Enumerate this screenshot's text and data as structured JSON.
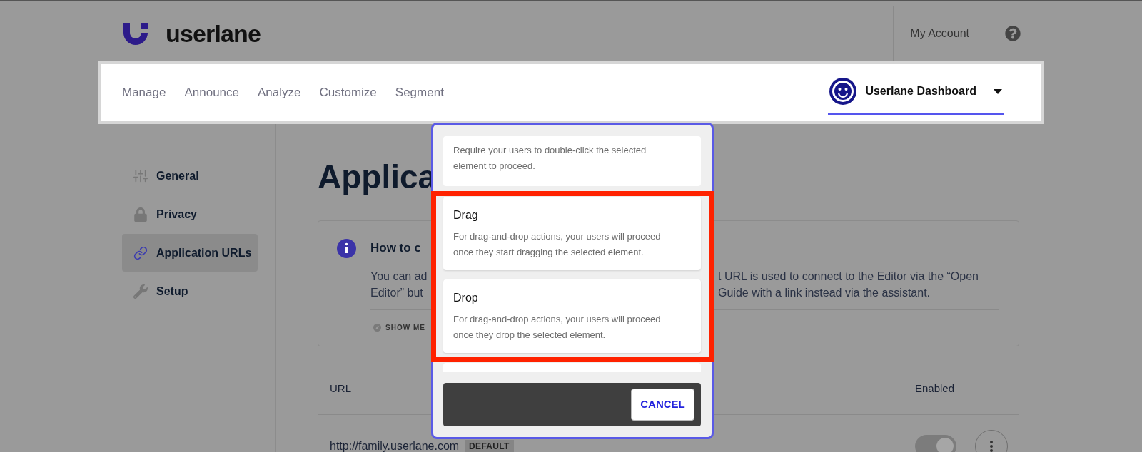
{
  "header": {
    "logo": "userlane",
    "account_link": "My Account"
  },
  "nav": {
    "items": [
      {
        "label": "Manage",
        "selected": false
      },
      {
        "label": "Announce",
        "selected": false
      },
      {
        "label": "Analyze",
        "selected": false
      },
      {
        "label": "Customize",
        "selected": false
      },
      {
        "label": "Segment",
        "selected": false
      }
    ],
    "workspace": {
      "name": "Userlane Dashboard",
      "selected": true
    }
  },
  "sidebar": {
    "items": [
      {
        "label": "General",
        "kind": "sliders",
        "selected": false
      },
      {
        "label": "Privacy",
        "kind": "lock",
        "selected": false
      },
      {
        "label": "Application URLs",
        "kind": "link",
        "selected": true
      },
      {
        "label": "Setup",
        "kind": "wrench",
        "selected": false
      }
    ]
  },
  "page": {
    "title": "Applica",
    "info": {
      "heading": "How to c",
      "lines": [
        {
          "left": "You can ad",
          "right": "t URL is used to connect to the Editor via the “Open"
        },
        {
          "left": "Editor” but",
          "right": "Guide with a link instead via the assistant."
        }
      ],
      "action": "SHOW ME"
    },
    "table": {
      "columns": [
        "URL",
        "Enabled"
      ],
      "rows": [
        {
          "url": "http://family.userlane.com",
          "badge": "DEFAULT",
          "enabled": true
        }
      ]
    }
  },
  "popup": {
    "options": [
      {
        "description": "Require your users to double-click the selected element to proceed.",
        "highlighted": false
      },
      {
        "title": "Drag",
        "description": "For drag-and-drop actions, your users will proceed once they start dragging the selected element.",
        "highlighted": true
      },
      {
        "title": "Drop",
        "description": "For drag-and-drop actions, your users will proceed once they drop the selected element.",
        "highlighted": true
      }
    ],
    "cancel": "CANCEL"
  }
}
